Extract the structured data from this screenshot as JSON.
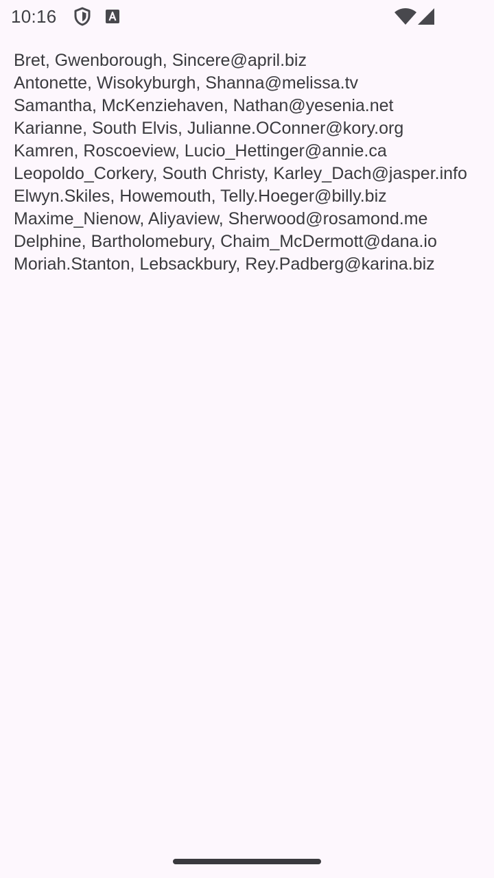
{
  "status_bar": {
    "time": "10:16",
    "icons": [
      "shield-icon",
      "font-download-icon",
      "wifi-icon",
      "cellular-signal-icon"
    ]
  },
  "users": [
    {
      "username": "Bret",
      "city": "Gwenborough",
      "email": "Sincere@april.biz",
      "line": "Bret, Gwenborough, Sincere@april.biz"
    },
    {
      "username": "Antonette",
      "city": "Wisokyburgh",
      "email": "Shanna@melissa.tv",
      "line": "Antonette, Wisokyburgh, Shanna@melissa.tv"
    },
    {
      "username": "Samantha",
      "city": "McKenziehaven",
      "email": "Nathan@yesenia.net",
      "line": "Samantha, McKenziehaven, Nathan@yesenia.net"
    },
    {
      "username": "Karianne",
      "city": "South Elvis",
      "email": "Julianne.OConner@kory.org",
      "line": "Karianne, South Elvis, Julianne.OConner@kory.org"
    },
    {
      "username": "Kamren",
      "city": "Roscoeview",
      "email": "Lucio_Hettinger@annie.ca",
      "line": "Kamren, Roscoeview, Lucio_Hettinger@annie.ca"
    },
    {
      "username": "Leopoldo_Corkery",
      "city": "South Christy",
      "email": "Karley_Dach@jasper.info",
      "line": "Leopoldo_Corkery, South Christy, Karley_Dach@jasper.info"
    },
    {
      "username": "Elwyn.Skiles",
      "city": "Howemouth",
      "email": "Telly.Hoeger@billy.biz",
      "line": "Elwyn.Skiles, Howemouth, Telly.Hoeger@billy.biz"
    },
    {
      "username": "Maxime_Nienow",
      "city": "Aliyaview",
      "email": "Sherwood@rosamond.me",
      "line": "Maxime_Nienow, Aliyaview, Sherwood@rosamond.me"
    },
    {
      "username": "Delphine",
      "city": "Bartholomebury",
      "email": "Chaim_McDermott@dana.io",
      "line": "Delphine, Bartholomebury, Chaim_McDermott@dana.io"
    },
    {
      "username": "Moriah.Stanton",
      "city": "Lebsackbury",
      "email": "Rey.Padberg@karina.biz",
      "line": "Moriah.Stanton, Lebsackbury, Rey.Padberg@karina.biz"
    }
  ],
  "colors": {
    "background": "#fdf7fd",
    "text": "#3a3a3e",
    "status_icons": "#48484d"
  }
}
